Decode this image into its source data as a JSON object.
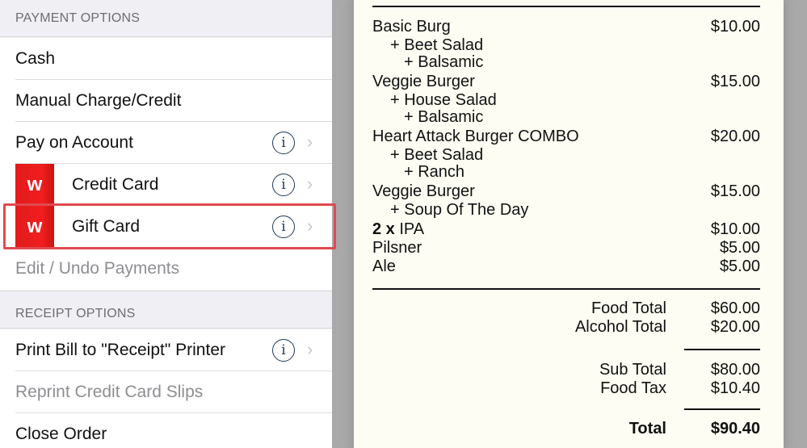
{
  "payment_options": {
    "header": "PAYMENT OPTIONS",
    "items": [
      {
        "label": "Cash"
      },
      {
        "label": "Manual Charge/Credit"
      },
      {
        "label": "Pay on Account",
        "info": "i",
        "chevron": "›"
      },
      {
        "label": "Credit Card",
        "badge": "w",
        "info": "i",
        "chevron": "›"
      },
      {
        "label": "Gift Card",
        "badge": "w",
        "info": "i",
        "chevron": "›"
      },
      {
        "label": "Edit / Undo Payments"
      }
    ]
  },
  "receipt_options": {
    "header": "RECEIPT OPTIONS",
    "items": [
      {
        "label": "Print Bill to \"Receipt\" Printer",
        "info": "i",
        "chevron": "›"
      },
      {
        "label": "Reprint Credit Card Slips"
      },
      {
        "label": "Close Order"
      }
    ]
  },
  "receipt": {
    "lines": [
      {
        "text": "Basic Burg",
        "amount": "$10.00"
      },
      {
        "text": "+ Beet Salad"
      },
      {
        "text": "+ Balsamic"
      },
      {
        "text": "Veggie Burger",
        "amount": "$15.00"
      },
      {
        "text": "+ House Salad"
      },
      {
        "text": "+ Balsamic"
      },
      {
        "text": "Heart Attack Burger COMBO",
        "amount": "$20.00"
      },
      {
        "text": "+ Beet Salad"
      },
      {
        "text": "+ Ranch"
      },
      {
        "text": "Veggie Burger",
        "amount": "$15.00"
      },
      {
        "text": "+ Soup Of The Day"
      },
      {
        "qty": "2 x",
        "text": "IPA",
        "amount": "$10.00"
      },
      {
        "text": "Pilsner",
        "amount": "$5.00"
      },
      {
        "text": "Ale",
        "amount": "$5.00"
      }
    ],
    "totals": [
      {
        "label": "Food Total",
        "amount": "$60.00"
      },
      {
        "label": "Alcohol Total",
        "amount": "$20.00"
      },
      {
        "label": "Sub Total",
        "amount": "$80.00"
      },
      {
        "label": "Food Tax",
        "amount": "$10.40"
      },
      {
        "label": "Total",
        "amount": "$90.40"
      }
    ]
  },
  "colors": {
    "accent_highlight": "#e14a4f",
    "badge_red": "#e21b1b",
    "info_icon": "#1f3a55"
  }
}
